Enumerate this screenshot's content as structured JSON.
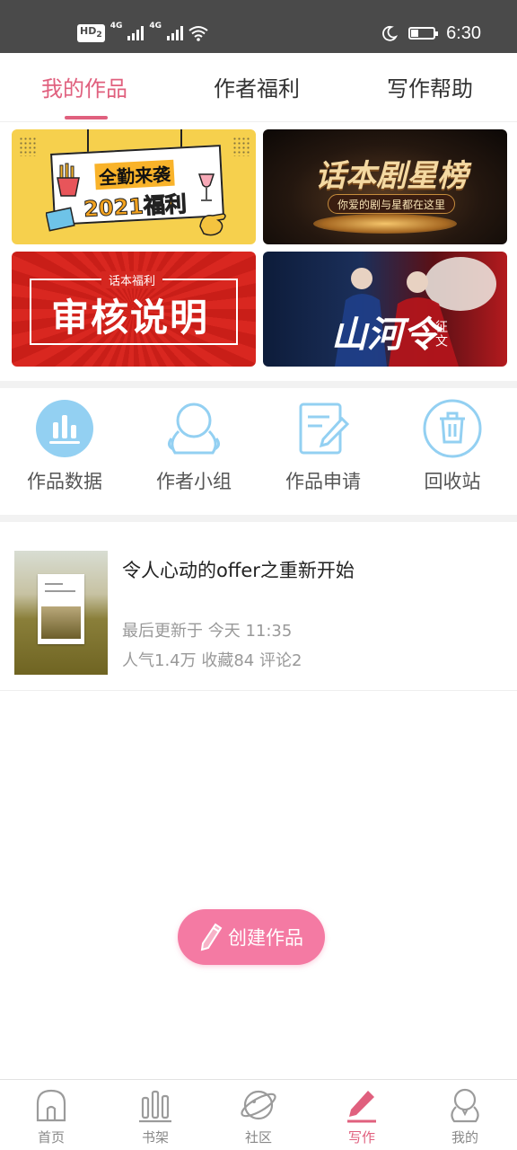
{
  "status_bar": {
    "hd": "HD",
    "hd_sub": "2",
    "network1": "4G",
    "network2": "4G",
    "time": "6:30"
  },
  "tabs": [
    {
      "label": "我的作品",
      "active": true
    },
    {
      "label": "作者福利",
      "active": false
    },
    {
      "label": "写作帮助",
      "active": false
    }
  ],
  "banners": {
    "b1": {
      "line1": "全勤来袭",
      "line2": "2021福利"
    },
    "b2": {
      "title": "话本剧星榜",
      "subtitle": "你爱的剧与星都在这里"
    },
    "b3": {
      "tag": "话本福利",
      "title": "审核说明"
    },
    "b4": {
      "title": "山河令",
      "subtitle": "征文"
    }
  },
  "quick_actions": [
    {
      "label": "作品数据",
      "icon": "bar-chart-icon"
    },
    {
      "label": "作者小组",
      "icon": "author-group-icon"
    },
    {
      "label": "作品申请",
      "icon": "apply-edit-icon"
    },
    {
      "label": "回收站",
      "icon": "trash-icon"
    }
  ],
  "work": {
    "title": "令人心动的offer之重新开始",
    "updated": "最后更新于 今天 11:35",
    "stats": "人气1.4万 收藏84 评论2"
  },
  "create_button": {
    "label": "创建作品"
  },
  "bottom_nav": [
    {
      "label": "首页",
      "icon": "home-icon",
      "active": false
    },
    {
      "label": "书架",
      "icon": "bookshelf-icon",
      "active": false
    },
    {
      "label": "社区",
      "icon": "community-planet-icon",
      "active": false
    },
    {
      "label": "写作",
      "icon": "write-pen-icon",
      "active": true
    },
    {
      "label": "我的",
      "icon": "profile-icon",
      "active": false
    }
  ],
  "colors": {
    "accent": "#e0607e",
    "create_button": "#f47aa3",
    "icon_blue": "#8fcbef",
    "status_bar": "#4a4a4a"
  }
}
